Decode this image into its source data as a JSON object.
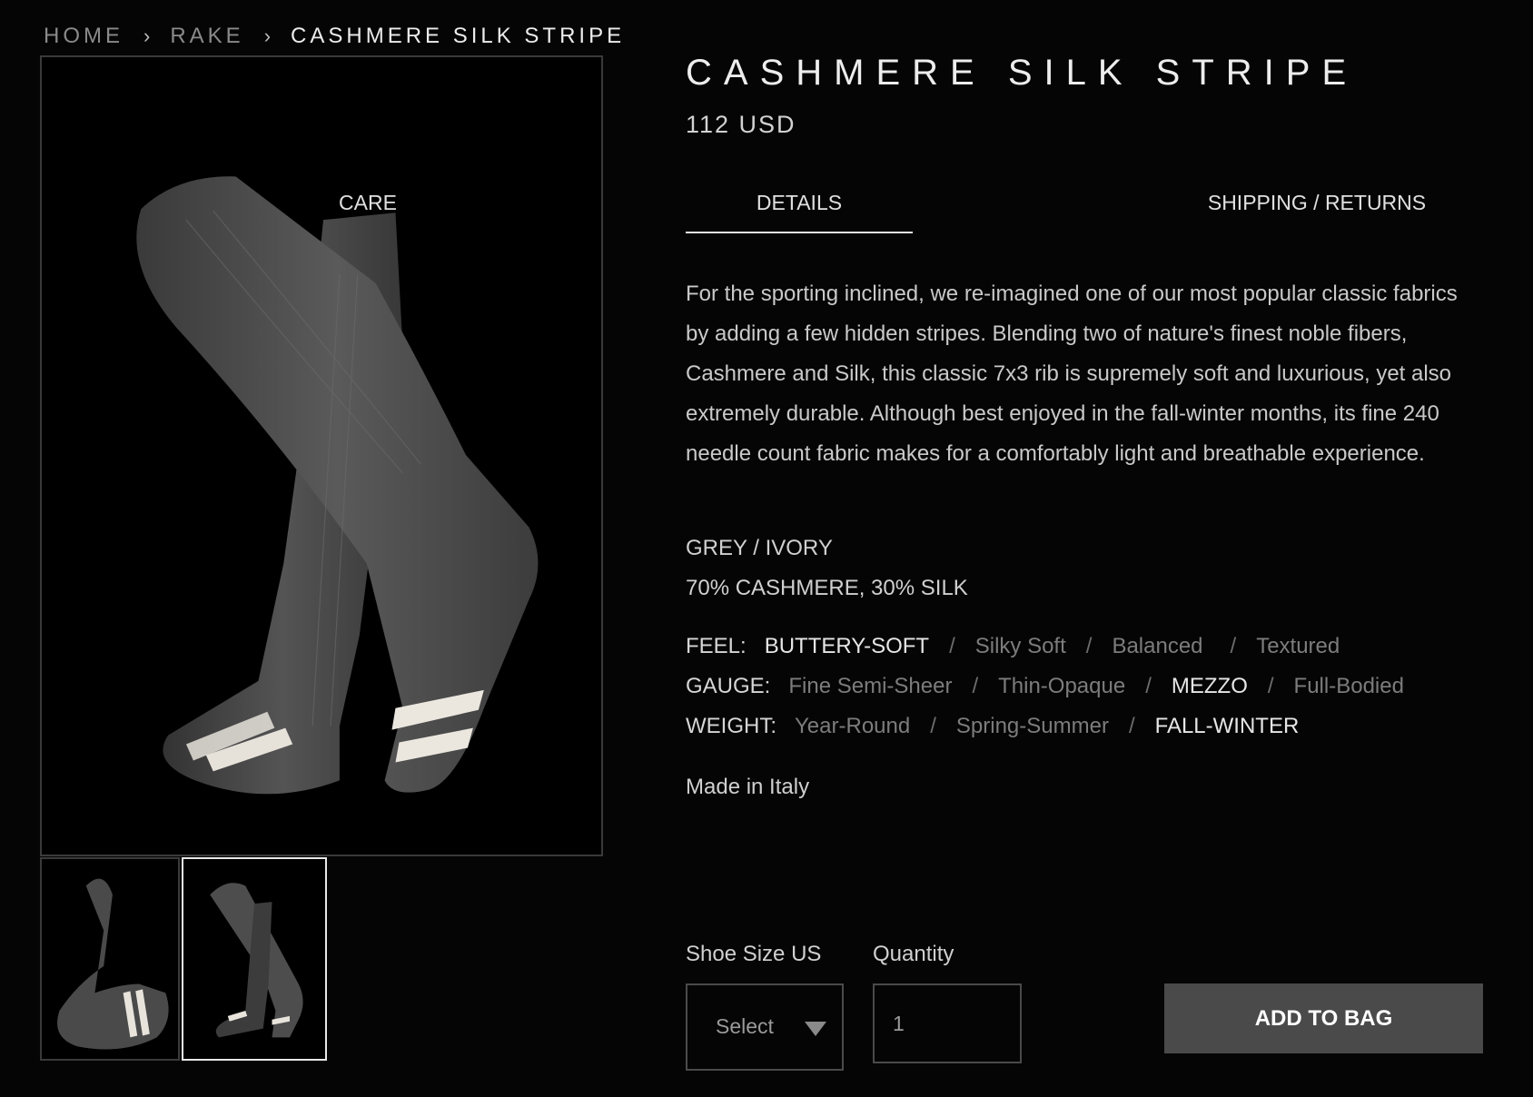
{
  "breadcrumb": {
    "items": [
      {
        "label": "HOME"
      },
      {
        "label": "RAKE"
      }
    ],
    "separator": "›",
    "current": "CASHMERE SILK STRIPE"
  },
  "product": {
    "title": "CASHMERE SILK STRIPE",
    "price": "112 USD"
  },
  "tabs": [
    {
      "label": "DETAILS",
      "active": true
    },
    {
      "label": "CARE",
      "active": false
    },
    {
      "label": "SHIPPING / RETURNS",
      "active": false
    }
  ],
  "details": {
    "description": "For the sporting inclined, we re-imagined one of our most popular classic fabrics by adding a few hidden stripes.  Blending two of nature's finest noble fibers, Cashmere and Silk, this classic 7x3 rib is supremely soft and luxurious, yet also extremely durable.  Although best enjoyed in the fall-winter months, its fine 240 needle count fabric makes for a comfortably light and breathable experience.",
    "color": "GREY / IVORY",
    "composition": "70% CASHMERE, 30% SILK",
    "feel": {
      "label": "FEEL:",
      "options": [
        "BUTTERY-SOFT",
        "Silky Soft",
        "Balanced",
        "Textured"
      ],
      "selected": "BUTTERY-SOFT"
    },
    "gauge": {
      "label": "GAUGE:",
      "options": [
        "Fine Semi-Sheer",
        "Thin-Opaque",
        "MEZZO",
        "Full-Bodied"
      ],
      "selected": "MEZZO"
    },
    "weight": {
      "label": "WEIGHT:",
      "options": [
        "Year-Round",
        "Spring-Summer",
        "FALL-WINTER"
      ],
      "selected": "FALL-WINTER"
    },
    "origin": "Made in Italy"
  },
  "purchase": {
    "size_label": "Shoe Size US",
    "size_value": "Select",
    "quantity_label": "Quantity",
    "quantity_value": "1",
    "add_button": "ADD TO BAG"
  },
  "colors": {
    "background": "#050505",
    "sock_grey": "#4d4d4d",
    "stripe_ivory": "#e8e4dc",
    "button": "#4a4a4a"
  }
}
